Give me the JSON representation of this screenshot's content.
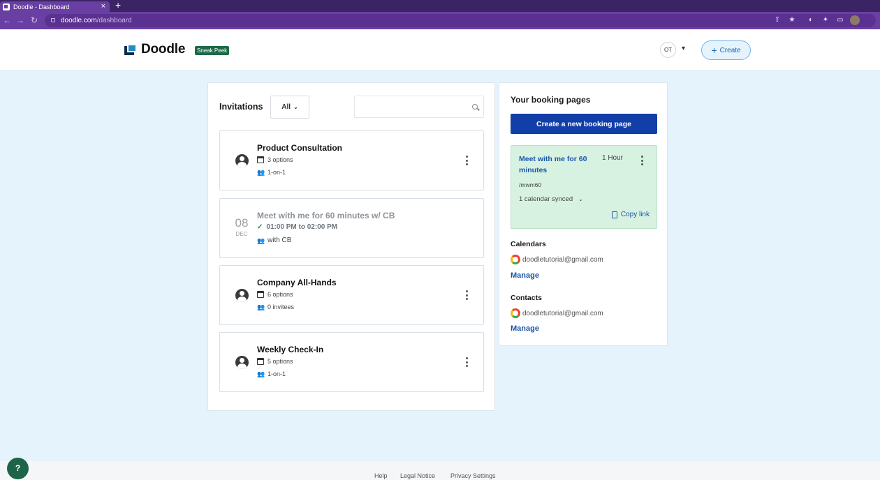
{
  "browser": {
    "tab_title": "Doodle - Dashboard",
    "tab_close": "×",
    "new_tab": "+",
    "url_host": "doodle.com",
    "url_path": "/dashboard",
    "nav_back": "←",
    "nav_forward": "→",
    "nav_reload": "↻"
  },
  "header": {
    "logo": "Doodle",
    "badge": "Sneak Peek",
    "user_initials": "OT",
    "create_label": "Create"
  },
  "invitations": {
    "title": "Invitations",
    "filter_label": "All",
    "search_placeholder": "",
    "cards": [
      {
        "title": "Product Consultation",
        "meta1": "3 options",
        "meta2": "1-on-1"
      },
      {
        "day": "08",
        "month": "DEC",
        "title": "Meet with me for 60 minutes w/ CB",
        "meta1": "01:00 PM to 02:00 PM",
        "meta2": "with CB"
      },
      {
        "title": "Company All-Hands",
        "meta1": "6 options",
        "meta2": "0 invitees"
      },
      {
        "title": "Weekly Check-In",
        "meta1": "5 options",
        "meta2": "1-on-1"
      }
    ]
  },
  "booking": {
    "title": "Your booking pages",
    "create_button": "Create a new booking page",
    "page": {
      "title": "Meet with me for 60 minutes",
      "duration": "1 Hour",
      "slug": "/mwm60",
      "calendars_synced": "1 calendar synced",
      "copy_link": "Copy link"
    },
    "calendars": {
      "label": "Calendars",
      "account": "doodletutorial@gmail.com",
      "manage": "Manage"
    },
    "contacts": {
      "label": "Contacts",
      "account": "doodletutorial@gmail.com",
      "manage": "Manage"
    }
  },
  "footer": {
    "links": [
      "Help",
      "Legal Notice",
      "Privacy Settings"
    ],
    "help_button": "?"
  },
  "colors": {
    "page_bg": "#e5f3fd",
    "primary": "#123ea7",
    "link": "#1a55a8",
    "booking_card_bg": "#d7f2e1",
    "brand_green": "#1c6a47"
  }
}
